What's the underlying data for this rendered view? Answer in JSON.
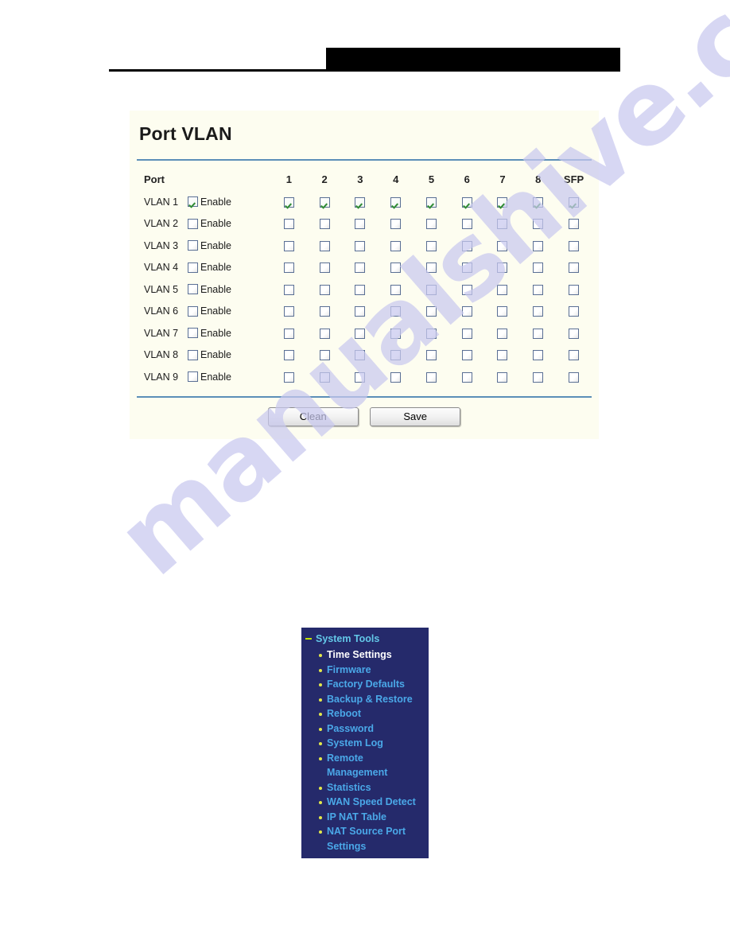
{
  "page": {
    "panel_title": "Port VLAN"
  },
  "watermark": {
    "text": "manualshive.com"
  },
  "colors": {
    "panel_background": "#fdfdf0",
    "divider_blue": "#5c8fb8",
    "nav_background": "#252a6b",
    "nav_head_text": "#63c8e8",
    "nav_item_text": "#4aa8e8",
    "nav_item_active_text": "#ffffff",
    "nav_bullet": "#e3e84a",
    "checkbox_border": "#5a6f94",
    "check_mark": "#2f8b34",
    "banner_black": "#000000",
    "watermark_purple": "#c9c9ef"
  },
  "table": {
    "header": [
      "Port",
      "1",
      "2",
      "3",
      "4",
      "5",
      "6",
      "7",
      "8",
      "SFP"
    ],
    "enable_label": "Enable",
    "rows": [
      {
        "name": "VLAN 1",
        "enable": true,
        "ports": [
          true,
          true,
          true,
          true,
          true,
          true,
          true,
          true,
          true
        ]
      },
      {
        "name": "VLAN 2",
        "enable": false,
        "ports": [
          false,
          false,
          false,
          false,
          false,
          false,
          false,
          false,
          false
        ]
      },
      {
        "name": "VLAN 3",
        "enable": false,
        "ports": [
          false,
          false,
          false,
          false,
          false,
          false,
          false,
          false,
          false
        ]
      },
      {
        "name": "VLAN 4",
        "enable": false,
        "ports": [
          false,
          false,
          false,
          false,
          false,
          false,
          false,
          false,
          false
        ]
      },
      {
        "name": "VLAN 5",
        "enable": false,
        "ports": [
          false,
          false,
          false,
          false,
          false,
          false,
          false,
          false,
          false
        ]
      },
      {
        "name": "VLAN 6",
        "enable": false,
        "ports": [
          false,
          false,
          false,
          false,
          false,
          false,
          false,
          false,
          false
        ]
      },
      {
        "name": "VLAN 7",
        "enable": false,
        "ports": [
          false,
          false,
          false,
          false,
          false,
          false,
          false,
          false,
          false
        ]
      },
      {
        "name": "VLAN 8",
        "enable": false,
        "ports": [
          false,
          false,
          false,
          false,
          false,
          false,
          false,
          false,
          false
        ]
      },
      {
        "name": "VLAN 9",
        "enable": false,
        "ports": [
          false,
          false,
          false,
          false,
          false,
          false,
          false,
          false,
          false
        ]
      }
    ]
  },
  "buttons": {
    "clean_label": "Clean",
    "save_label": "Save"
  },
  "nav_menu": {
    "heading": "System Tools",
    "items": [
      {
        "label": "Time Settings",
        "active": true
      },
      {
        "label": "Firmware",
        "active": false
      },
      {
        "label": "Factory Defaults",
        "active": false
      },
      {
        "label": "Backup & Restore",
        "active": false
      },
      {
        "label": "Reboot",
        "active": false
      },
      {
        "label": "Password",
        "active": false
      },
      {
        "label": "System Log",
        "active": false
      },
      {
        "label": "Remote Management",
        "active": false
      },
      {
        "label": "Statistics",
        "active": false
      },
      {
        "label": "WAN Speed Detect",
        "active": false
      },
      {
        "label": "IP NAT Table",
        "active": false
      },
      {
        "label": "NAT Source Port Settings",
        "active": false
      }
    ]
  }
}
